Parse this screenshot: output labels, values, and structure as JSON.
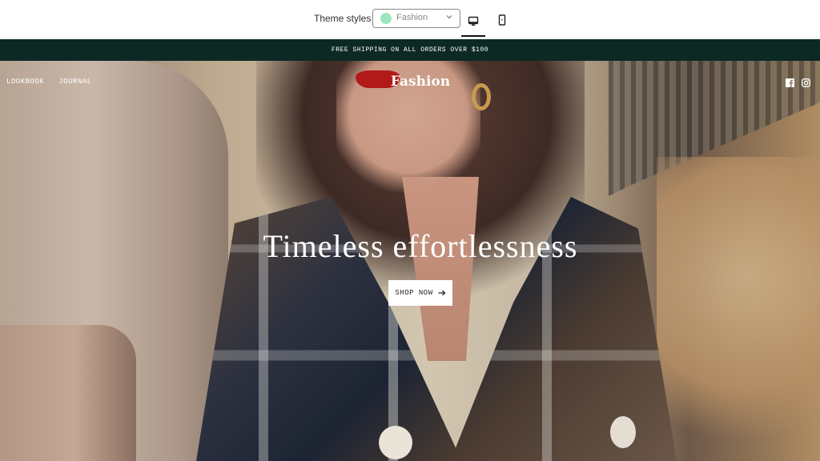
{
  "toolbar": {
    "theme_label": "Theme styles",
    "theme_select": {
      "value": "Fashion",
      "swatch_color": "#9ee6bf"
    },
    "view_buttons": [
      {
        "name": "desktop-icon",
        "active": true
      },
      {
        "name": "mobile-icon",
        "active": false
      }
    ]
  },
  "announcement": {
    "text": "FREE SHIPPING ON ALL ORDERS OVER $100",
    "background": "#0c2924"
  },
  "hero": {
    "nav_items": [
      "LOOKBOOK",
      "JOURNAL"
    ],
    "brand": "Fashion",
    "social_icons": [
      "facebook-icon",
      "instagram-icon"
    ],
    "headline": "Timeless effortlessness",
    "cta_label": "SHOP NOW",
    "cta_icon": "arrow-right-icon"
  }
}
